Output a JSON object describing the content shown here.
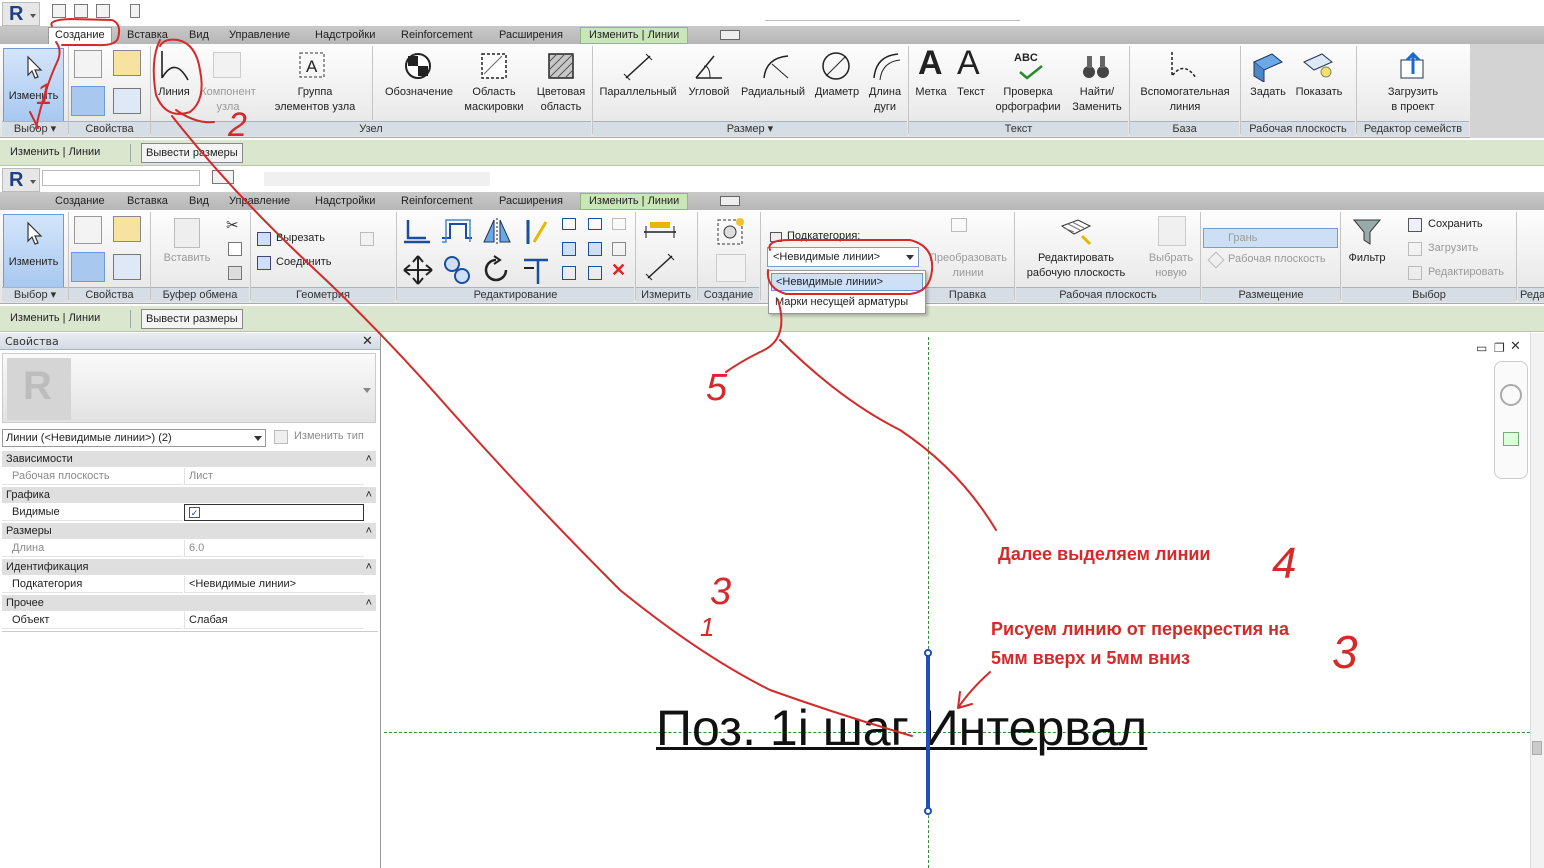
{
  "ribbon1": {
    "tabs": [
      "Создание",
      "Вставка",
      "Вид",
      "Управление",
      "Надстройки",
      "Reinforcement",
      "Расширения",
      "Изменить | Линии"
    ],
    "buttons": {
      "modify": "Изменить",
      "line": "Линия",
      "component_l1": "Компонент",
      "component_l2": "узла",
      "group_l1": "Группа",
      "group_l2": "элементов узла",
      "symbol": "Обозначение",
      "masking_l1": "Область",
      "masking_l2": "маскировки",
      "filled_l1": "Цветовая",
      "filled_l2": "область",
      "aligned": "Параллельный",
      "angular": "Угловой",
      "radial": "Радиальный",
      "diameter": "Диаметр",
      "arc_l1": "Длина",
      "arc_l2": "дуги",
      "label": "Метка",
      "text": "Текст",
      "spell_l1": "Проверка",
      "spell_l2": "орфографии",
      "find_l1": "Найти/",
      "find_l2": "Заменить",
      "ref_l1": "Вспомогательная",
      "ref_l2": "линия",
      "set": "Задать",
      "show": "Показать",
      "load_l1": "Загрузить",
      "load_l2": "в проект",
      "abc": "ABC"
    },
    "panels": [
      "Выбор ▾",
      "Свойства",
      "Узел",
      "Размер ▾",
      "Текст",
      "База",
      "Рабочая плоскость",
      "Редактор семейств"
    ]
  },
  "optbar": {
    "context": "Изменить | Линии",
    "button": "Вывести размеры"
  },
  "ribbon2": {
    "tabs": [
      "Создание",
      "Вставка",
      "Вид",
      "Управление",
      "Надстройки",
      "Reinforcement",
      "Расширения",
      "Изменить | Линии"
    ],
    "buttons": {
      "modify": "Изменить",
      "paste": "Вставить",
      "cut": "Вырезать",
      "join": "Соединить",
      "subcategory_label": "Подкатегория:",
      "subcategory_value": "<Невидимые линии>",
      "convert_l1": "Преобразовать",
      "convert_l2": "линии",
      "editwp_l1": "Редактировать",
      "editwp_l2": "рабочую плоскость",
      "pick_l1": "Выбрать",
      "pick_l2": "новую",
      "face": "Грань",
      "wplane": "Рабочая плоскость",
      "filter": "Фильтр",
      "save": "Сохранить",
      "load": "Загрузить",
      "edit": "Редактировать"
    },
    "dropdown_options": [
      "<Невидимые линии>",
      "Марки несущей арматуры"
    ],
    "panels": [
      "Выбор ▾",
      "Свойства",
      "Буфер обмена",
      "Геометрия",
      "Редактирование",
      "Измерить",
      "Создание",
      "Правка",
      "Рабочая плоскость",
      "Размещение",
      "Выбор",
      "Реда"
    ]
  },
  "properties": {
    "title": "Свойства",
    "type_selector": "Линии (<Невидимые линии>) (2)",
    "edit_type": "Изменить тип",
    "sections": [
      {
        "name": "Зависимости",
        "rows": [
          {
            "k": "Рабочая плоскость",
            "v": "Лист",
            "dim": true
          }
        ]
      },
      {
        "name": "Графика",
        "rows": [
          {
            "k": "Видимые",
            "v": "✓",
            "dim": false
          }
        ]
      },
      {
        "name": "Размеры",
        "rows": [
          {
            "k": "Длина",
            "v": "6.0",
            "dim": true
          }
        ]
      },
      {
        "name": "Идентификация",
        "rows": [
          {
            "k": "Подкатегория",
            "v": "<Невидимые линии>",
            "dim": false
          }
        ]
      },
      {
        "name": "Прочее",
        "rows": [
          {
            "k": "Объект",
            "v": "Слабая",
            "dim": false
          }
        ]
      }
    ]
  },
  "canvas": {
    "main_text": "Поз. 1i шаг Интервал",
    "note1": "Далее выделяем линии",
    "note2_l1": "Рисуем линию от перекрестия на",
    "note2_l2": "5мм вверх и 5мм вниз"
  },
  "annotations": {
    "n1": "1",
    "n2": "2",
    "n3": "3",
    "n4": "4",
    "n5": "5"
  },
  "colors": {
    "context_tab": "#c9e6b8",
    "annotation_red": "#d42a2a",
    "line_blue": "#1f4fbf",
    "options_bar": "#dbe6cf"
  }
}
